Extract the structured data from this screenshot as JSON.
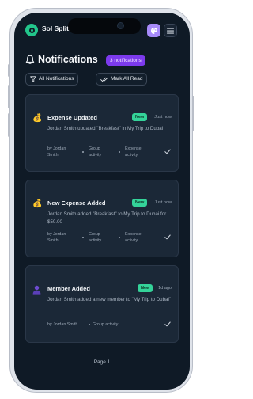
{
  "app": {
    "title": "Sol Splitter"
  },
  "header": {
    "title": "Notifications",
    "count_badge": "3 notifications"
  },
  "filters": {
    "all_label": "All Notifications",
    "mark_read_label": "Mark All Read"
  },
  "notifications": [
    {
      "icon": "money-bag-icon",
      "title": "Expense Updated",
      "badge": "New",
      "time": "Just now",
      "message": "Jordan Smith updated \"Breakfast\" in My Trip to Dubai",
      "meta_by": "by Jordan Smith",
      "meta_scope": "Group activity",
      "meta_type": "Expense activity"
    },
    {
      "icon": "money-bag-icon",
      "title": "New Expense Added",
      "badge": "New",
      "time": "Just now",
      "message": "Jordan Smith added \"Breakfast\" to My Trip to Dubai for $50.00",
      "meta_by": "by Jordan Smith",
      "meta_scope": "Group activity",
      "meta_type": "Expense activity"
    },
    {
      "icon": "person-icon",
      "title": "Member Added",
      "badge": "New",
      "time": "1d ago",
      "message": "Jordan Smith added a new member to \"My Trip to Dubai\"",
      "meta_by": "by Jordan Smith",
      "meta_scope": "Group activity"
    }
  ],
  "pagination": {
    "label": "Page 1"
  },
  "colors": {
    "background": "#0f1a26",
    "card": "#1b2837",
    "accent_purple": "#7c3aed",
    "new_badge": "#34d399",
    "logo_green": "#22c58b"
  }
}
